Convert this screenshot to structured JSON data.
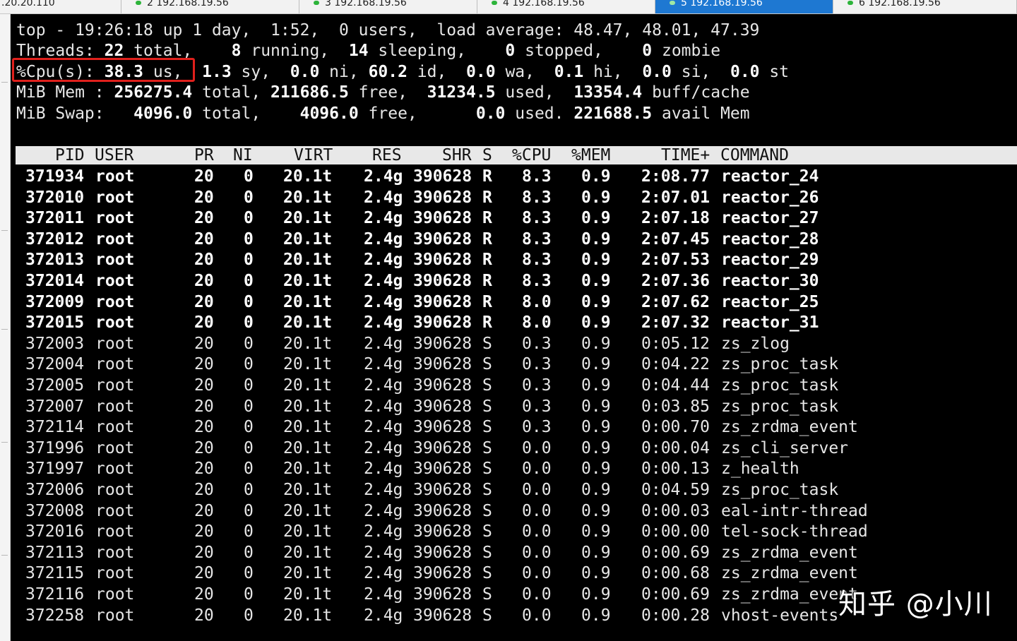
{
  "tabs": [
    {
      "label": ".20.20.110",
      "active": false
    },
    {
      "label": "2 192.168.19.56",
      "active": false
    },
    {
      "label": "3 192.168.19.56",
      "active": false
    },
    {
      "label": "4 192.168.19.56",
      "active": false
    },
    {
      "label": "5 192.168.19.56",
      "active": true
    },
    {
      "label": "6 192.168.19.56",
      "active": false
    }
  ],
  "summary": {
    "top_line": "top - 19:26:18 up 1 day,  1:52,  0 users,  load average: 48.47, 48.01, 47.39",
    "threads_label": "Threads:",
    "threads_total": " 22",
    "threads_total_word": " total,   ",
    "threads_running": " 8",
    "threads_running_word": " running,  ",
    "threads_sleeping": "14",
    "threads_sleeping_word": " sleeping,   ",
    "threads_stopped": " 0",
    "threads_stopped_word": " stopped,   ",
    "threads_zombie": " 0",
    "threads_zombie_word": " zombie",
    "cpu_label": "%Cpu(s):",
    "cpu_us": " 38.3",
    "cpu_us_word": " us, ",
    "cpu_sy": " 1.3",
    "cpu_sy_word": " sy,  ",
    "cpu_ni": "0.0",
    "cpu_ni_word": " ni, ",
    "cpu_id": "60.2",
    "cpu_id_word": " id,  ",
    "cpu_wa": "0.0",
    "cpu_wa_word": " wa,  ",
    "cpu_hi": "0.1",
    "cpu_hi_word": " hi,  ",
    "cpu_si": "0.0",
    "cpu_si_word": " si,  ",
    "cpu_st": "0.0",
    "cpu_st_word": " st",
    "mem_label": "MiB Mem : ",
    "mem_total": "256275.4",
    "mem_total_word": " total, ",
    "mem_free": "211686.5",
    "mem_free_word": " free,  ",
    "mem_used": "31234.5",
    "mem_used_word": " used,  ",
    "mem_buff": "13354.4",
    "mem_buff_word": " buff/cache",
    "swap_label": "MiB Swap:   ",
    "swap_total": "4096.0",
    "swap_total_word": " total,    ",
    "swap_free": "4096.0",
    "swap_free_word": " free,      ",
    "swap_used": "0.0",
    "swap_used_word": " used. ",
    "swap_avail": "221688.5",
    "swap_avail_word": " avail Mem"
  },
  "columns": {
    "pid": "PID",
    "user": "USER",
    "pr": "PR",
    "ni": "NI",
    "virt": "VIRT",
    "res": "RES",
    "shr": "SHR",
    "s": "S",
    "cpu": "%CPU",
    "mem": "%MEM",
    "time": "TIME+",
    "command": "COMMAND"
  },
  "processes": [
    {
      "pid": "371934",
      "user": "root",
      "pr": "20",
      "ni": "0",
      "virt": "20.1t",
      "res": "2.4g",
      "shr": "390628",
      "s": "R",
      "cpu": "8.3",
      "mem": "0.9",
      "time": "2:08.77",
      "command": "reactor_24"
    },
    {
      "pid": "372010",
      "user": "root",
      "pr": "20",
      "ni": "0",
      "virt": "20.1t",
      "res": "2.4g",
      "shr": "390628",
      "s": "R",
      "cpu": "8.3",
      "mem": "0.9",
      "time": "2:07.01",
      "command": "reactor_26"
    },
    {
      "pid": "372011",
      "user": "root",
      "pr": "20",
      "ni": "0",
      "virt": "20.1t",
      "res": "2.4g",
      "shr": "390628",
      "s": "R",
      "cpu": "8.3",
      "mem": "0.9",
      "time": "2:07.18",
      "command": "reactor_27"
    },
    {
      "pid": "372012",
      "user": "root",
      "pr": "20",
      "ni": "0",
      "virt": "20.1t",
      "res": "2.4g",
      "shr": "390628",
      "s": "R",
      "cpu": "8.3",
      "mem": "0.9",
      "time": "2:07.45",
      "command": "reactor_28"
    },
    {
      "pid": "372013",
      "user": "root",
      "pr": "20",
      "ni": "0",
      "virt": "20.1t",
      "res": "2.4g",
      "shr": "390628",
      "s": "R",
      "cpu": "8.3",
      "mem": "0.9",
      "time": "2:07.53",
      "command": "reactor_29"
    },
    {
      "pid": "372014",
      "user": "root",
      "pr": "20",
      "ni": "0",
      "virt": "20.1t",
      "res": "2.4g",
      "shr": "390628",
      "s": "R",
      "cpu": "8.3",
      "mem": "0.9",
      "time": "2:07.36",
      "command": "reactor_30"
    },
    {
      "pid": "372009",
      "user": "root",
      "pr": "20",
      "ni": "0",
      "virt": "20.1t",
      "res": "2.4g",
      "shr": "390628",
      "s": "R",
      "cpu": "8.0",
      "mem": "0.9",
      "time": "2:07.62",
      "command": "reactor_25"
    },
    {
      "pid": "372015",
      "user": "root",
      "pr": "20",
      "ni": "0",
      "virt": "20.1t",
      "res": "2.4g",
      "shr": "390628",
      "s": "R",
      "cpu": "8.0",
      "mem": "0.9",
      "time": "2:07.32",
      "command": "reactor_31"
    },
    {
      "pid": "372003",
      "user": "root",
      "pr": "20",
      "ni": "0",
      "virt": "20.1t",
      "res": "2.4g",
      "shr": "390628",
      "s": "S",
      "cpu": "0.3",
      "mem": "0.9",
      "time": "0:05.12",
      "command": "zs_zlog"
    },
    {
      "pid": "372004",
      "user": "root",
      "pr": "20",
      "ni": "0",
      "virt": "20.1t",
      "res": "2.4g",
      "shr": "390628",
      "s": "S",
      "cpu": "0.3",
      "mem": "0.9",
      "time": "0:04.22",
      "command": "zs_proc_task"
    },
    {
      "pid": "372005",
      "user": "root",
      "pr": "20",
      "ni": "0",
      "virt": "20.1t",
      "res": "2.4g",
      "shr": "390628",
      "s": "S",
      "cpu": "0.3",
      "mem": "0.9",
      "time": "0:04.44",
      "command": "zs_proc_task"
    },
    {
      "pid": "372007",
      "user": "root",
      "pr": "20",
      "ni": "0",
      "virt": "20.1t",
      "res": "2.4g",
      "shr": "390628",
      "s": "S",
      "cpu": "0.3",
      "mem": "0.9",
      "time": "0:03.85",
      "command": "zs_proc_task"
    },
    {
      "pid": "372114",
      "user": "root",
      "pr": "20",
      "ni": "0",
      "virt": "20.1t",
      "res": "2.4g",
      "shr": "390628",
      "s": "S",
      "cpu": "0.3",
      "mem": "0.9",
      "time": "0:00.70",
      "command": "zs_zrdma_event"
    },
    {
      "pid": "371996",
      "user": "root",
      "pr": "20",
      "ni": "0",
      "virt": "20.1t",
      "res": "2.4g",
      "shr": "390628",
      "s": "S",
      "cpu": "0.0",
      "mem": "0.9",
      "time": "0:00.04",
      "command": "zs_cli_server"
    },
    {
      "pid": "371997",
      "user": "root",
      "pr": "20",
      "ni": "0",
      "virt": "20.1t",
      "res": "2.4g",
      "shr": "390628",
      "s": "S",
      "cpu": "0.0",
      "mem": "0.9",
      "time": "0:00.13",
      "command": "z_health"
    },
    {
      "pid": "372006",
      "user": "root",
      "pr": "20",
      "ni": "0",
      "virt": "20.1t",
      "res": "2.4g",
      "shr": "390628",
      "s": "S",
      "cpu": "0.0",
      "mem": "0.9",
      "time": "0:04.59",
      "command": "zs_proc_task"
    },
    {
      "pid": "372008",
      "user": "root",
      "pr": "20",
      "ni": "0",
      "virt": "20.1t",
      "res": "2.4g",
      "shr": "390628",
      "s": "S",
      "cpu": "0.0",
      "mem": "0.9",
      "time": "0:00.03",
      "command": "eal-intr-thread"
    },
    {
      "pid": "372016",
      "user": "root",
      "pr": "20",
      "ni": "0",
      "virt": "20.1t",
      "res": "2.4g",
      "shr": "390628",
      "s": "S",
      "cpu": "0.0",
      "mem": "0.9",
      "time": "0:00.00",
      "command": "tel-sock-thread"
    },
    {
      "pid": "372113",
      "user": "root",
      "pr": "20",
      "ni": "0",
      "virt": "20.1t",
      "res": "2.4g",
      "shr": "390628",
      "s": "S",
      "cpu": "0.0",
      "mem": "0.9",
      "time": "0:00.69",
      "command": "zs_zrdma_event"
    },
    {
      "pid": "372115",
      "user": "root",
      "pr": "20",
      "ni": "0",
      "virt": "20.1t",
      "res": "2.4g",
      "shr": "390628",
      "s": "S",
      "cpu": "0.0",
      "mem": "0.9",
      "time": "0:00.68",
      "command": "zs_zrdma_event"
    },
    {
      "pid": "372116",
      "user": "root",
      "pr": "20",
      "ni": "0",
      "virt": "20.1t",
      "res": "2.4g",
      "shr": "390628",
      "s": "S",
      "cpu": "0.0",
      "mem": "0.9",
      "time": "0:00.69",
      "command": "zs_zrdma_event"
    },
    {
      "pid": "372258",
      "user": "root",
      "pr": "20",
      "ni": "0",
      "virt": "20.1t",
      "res": "2.4g",
      "shr": "390628",
      "s": "S",
      "cpu": "0.0",
      "mem": "0.9",
      "time": "0:00.28",
      "command": "vhost-events"
    }
  ],
  "watermark": "知乎 @小川",
  "colors": {
    "highlight": "#e0201c",
    "tab_active": "#1e78d2",
    "status_dot": "#2db43a"
  }
}
